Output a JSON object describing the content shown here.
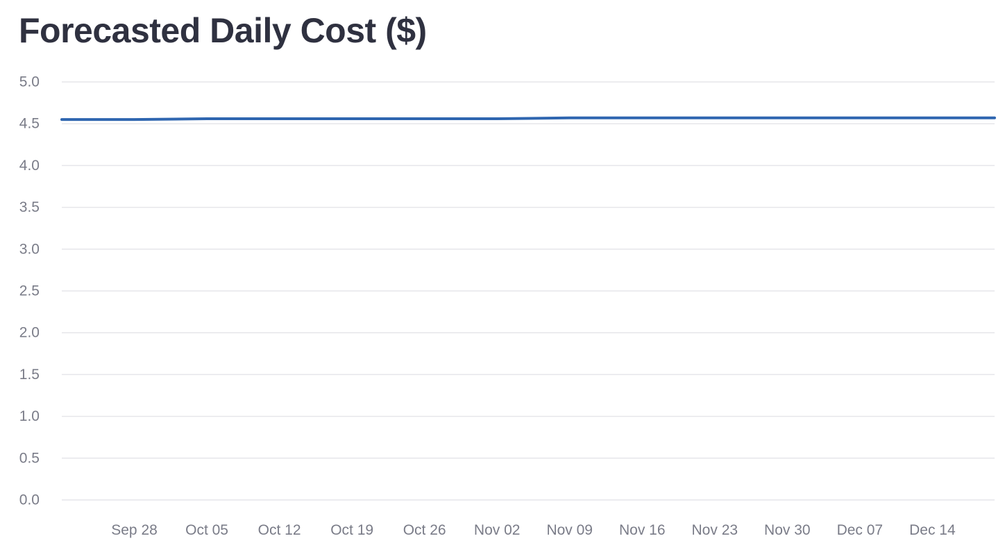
{
  "chart_title": "Forecasted Daily Cost ($)",
  "chart_data": {
    "type": "line",
    "title": "Forecasted Daily Cost ($)",
    "xlabel": "",
    "ylabel": "",
    "ylim": [
      0,
      5
    ],
    "xlim": [
      "2024-09-21",
      "2024-12-20"
    ],
    "y_ticks": [
      0,
      0.5,
      1.0,
      1.5,
      2.0,
      2.5,
      3.0,
      3.5,
      4.0,
      4.5,
      5.0
    ],
    "y_tick_labels": [
      "0.0",
      "0.5",
      "1.0",
      "1.5",
      "2.0",
      "2.5",
      "3.0",
      "3.5",
      "4.0",
      "4.5",
      "5.0"
    ],
    "x_ticks": [
      "2024-09-28",
      "2024-10-05",
      "2024-10-12",
      "2024-10-19",
      "2024-10-26",
      "2024-11-02",
      "2024-11-09",
      "2024-11-16",
      "2024-11-23",
      "2024-11-30",
      "2024-12-07",
      "2024-12-14"
    ],
    "x_tick_labels": [
      "Sep 28",
      "Oct 05",
      "Oct 12",
      "Oct 19",
      "Oct 26",
      "Nov 02",
      "Nov 09",
      "Nov 16",
      "Nov 23",
      "Nov 30",
      "Dec 07",
      "Dec 14"
    ],
    "grid": true,
    "legend": "none",
    "series": [
      {
        "color": "#2f66b0",
        "x": [
          "2024-09-21",
          "2024-09-28",
          "2024-10-05",
          "2024-10-12",
          "2024-10-19",
          "2024-10-26",
          "2024-11-02",
          "2024-11-09",
          "2024-11-16",
          "2024-11-23",
          "2024-11-30",
          "2024-12-07",
          "2024-12-14",
          "2024-12-20"
        ],
        "y": [
          4.55,
          4.55,
          4.56,
          4.56,
          4.56,
          4.56,
          4.56,
          4.57,
          4.57,
          4.57,
          4.57,
          4.57,
          4.57,
          4.57
        ]
      }
    ]
  }
}
